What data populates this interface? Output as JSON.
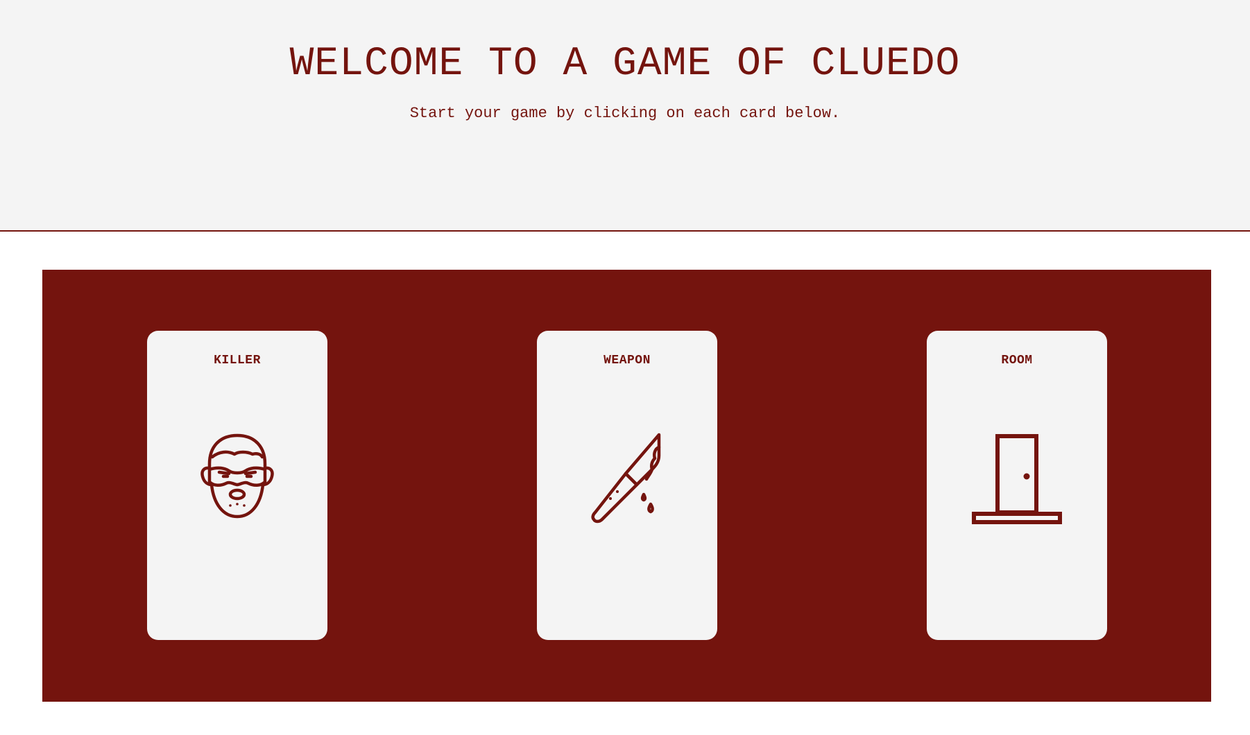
{
  "header": {
    "title": "WELCOME TO A GAME OF CLUEDO",
    "subtitle": "Start your game by clicking on each card below."
  },
  "cards": [
    {
      "label": "KILLER",
      "icon": "killer-mask-icon"
    },
    {
      "label": "WEAPON",
      "icon": "bloody-knife-icon"
    },
    {
      "label": "ROOM",
      "icon": "door-icon"
    }
  ],
  "colors": {
    "accent": "#74140e",
    "card_background": "#f4f4f4",
    "header_background": "#f4f4f4"
  }
}
